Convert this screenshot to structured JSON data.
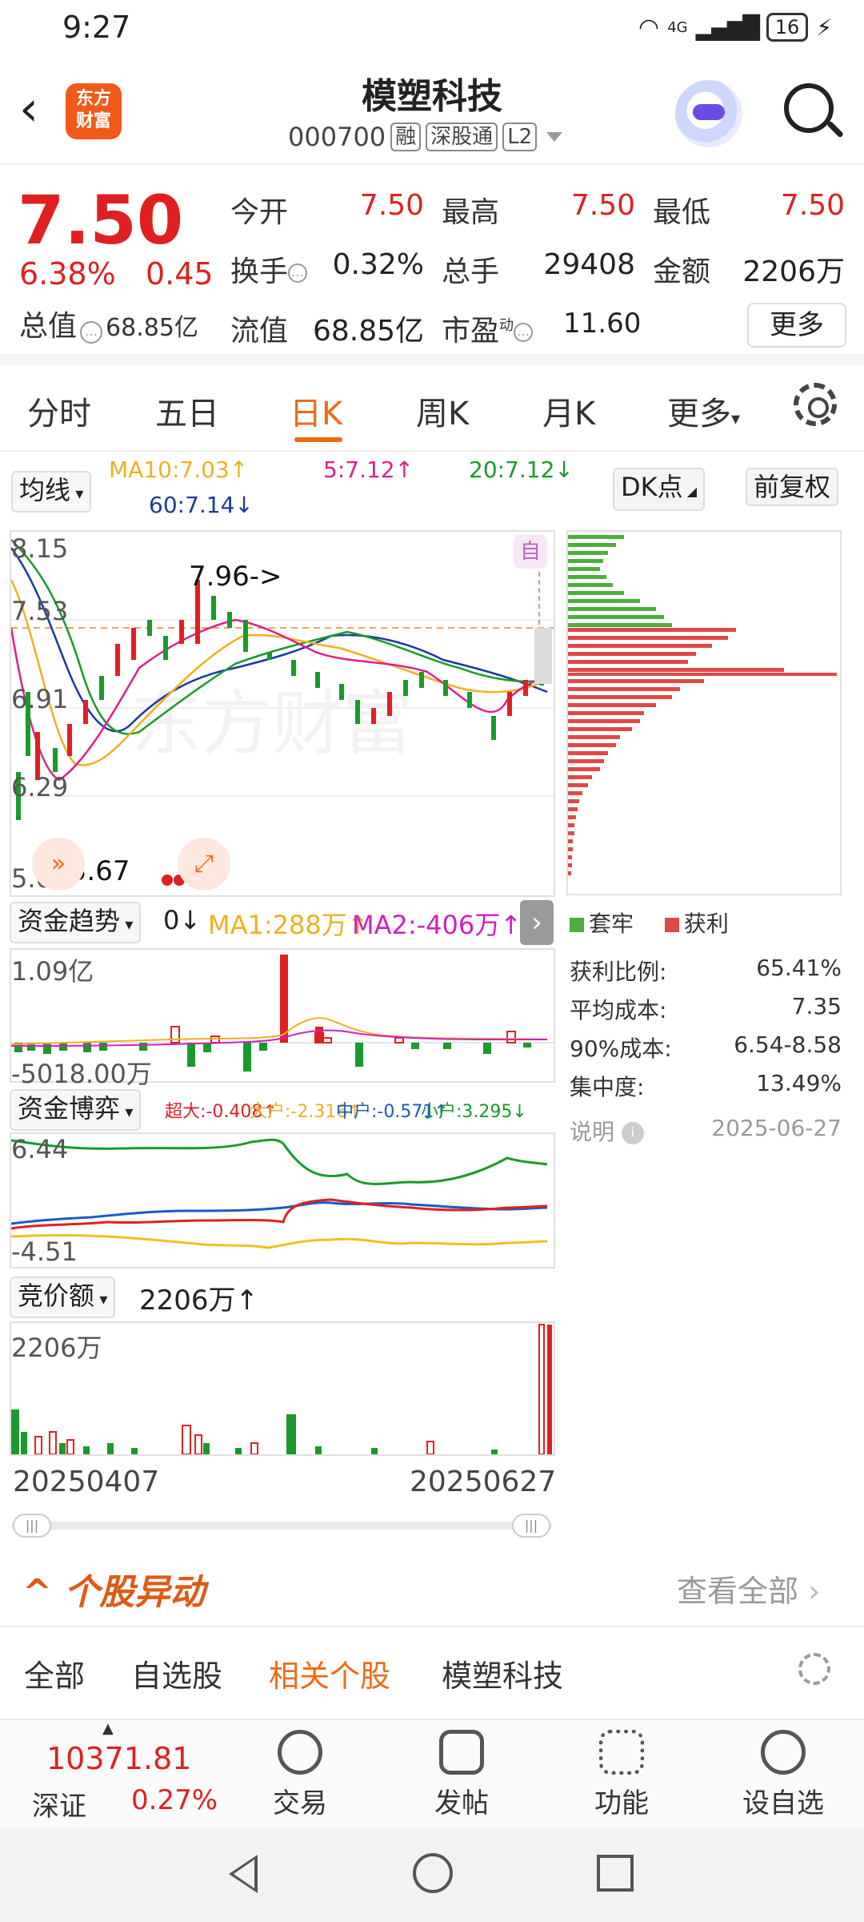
{
  "status_bar": {
    "time": "9:27",
    "network": "4G",
    "battery": "16"
  },
  "header": {
    "logo_line1": "东方",
    "logo_line2": "财富",
    "title": "模塑科技",
    "code": "000700",
    "tags": [
      "融",
      "深股通",
      "L2"
    ]
  },
  "quote": {
    "price": "7.50",
    "change_pct": "6.38%",
    "change_amt": "0.45",
    "total_value_label": "总值",
    "total_value": "68.85亿",
    "fields": {
      "open_label": "今开",
      "open": "7.50",
      "high_label": "最高",
      "high": "7.50",
      "low_label": "最低",
      "low": "7.50",
      "turnover_label": "换手",
      "turnover": "0.32%",
      "volume_label": "总手",
      "volume": "29408",
      "amount_label": "金额",
      "amount": "2206万",
      "float_label": "流值",
      "float_value": "68.85亿",
      "pe_label": "市盈",
      "pe_sup": "动",
      "pe": "11.60"
    },
    "more_button": "更多"
  },
  "tabs": [
    "分时",
    "五日",
    "日K",
    "周K",
    "月K",
    "更多"
  ],
  "active_tab": "日K",
  "ma_row": {
    "selector": "均线",
    "ma10": "MA10:7.03↑",
    "ma5": "5:7.12↑",
    "ma20": "20:7.12↓",
    "ma60": "60:7.14↓",
    "dk_button": "DK点",
    "adjust_button": "前复权"
  },
  "kline": {
    "y_labels": [
      "8.15",
      "7.53",
      "6.91",
      "6.29",
      "5.67"
    ],
    "high_annotation": "7.96->",
    "low_annotation": "<-5.67",
    "self_badge": "自",
    "watermark": "东方财富"
  },
  "chips": {
    "legend_trapped": "套牢",
    "legend_profit": "获利",
    "stats": [
      {
        "label": "获利比例:",
        "value": "65.41%"
      },
      {
        "label": "平均成本:",
        "value": "7.35"
      },
      {
        "label": "90%成本:",
        "value": "6.54-8.58"
      },
      {
        "label": "集中度:",
        "value": "13.49%"
      }
    ],
    "note_label": "说明",
    "date": "2025-06-27"
  },
  "fund_trend": {
    "selector": "资金趋势",
    "value": "0↓",
    "ma1": "MA1:288万↑",
    "ma2": "MA2:-406万↑",
    "y_top": "1.09亿",
    "y_bottom": "-5018.00万"
  },
  "fund_game": {
    "selector": "资金博弈",
    "super": "超大:-0.408↑",
    "big": "大户:-2.316↑",
    "mid": "中户:-0.571↑",
    "small": "小户:3.295↓",
    "y_top": "6.44",
    "y_bottom": "-4.51"
  },
  "auction": {
    "selector": "竞价额",
    "value": "2206万↑",
    "y_top": "2206万",
    "date_start": "20250407",
    "date_end": "20250627"
  },
  "abnormal": {
    "title": "个股异动",
    "view_all": "查看全部"
  },
  "subtabs": [
    "全部",
    "自选股",
    "相关个股",
    "模塑科技"
  ],
  "active_subtab": "相关个股",
  "bottom_bar": {
    "index_value": "10371.81",
    "index_name": "深证",
    "index_change": "0.27%",
    "items": [
      "交易",
      "发帖",
      "功能",
      "设自选"
    ]
  },
  "colors": {
    "up": "#e02020",
    "down": "#1a9a2a",
    "accent": "#f06a14",
    "ma5": "#e01e8c",
    "ma10": "#f0b020",
    "ma20": "#1a9a2a",
    "ma60": "#1a3aa0"
  }
}
